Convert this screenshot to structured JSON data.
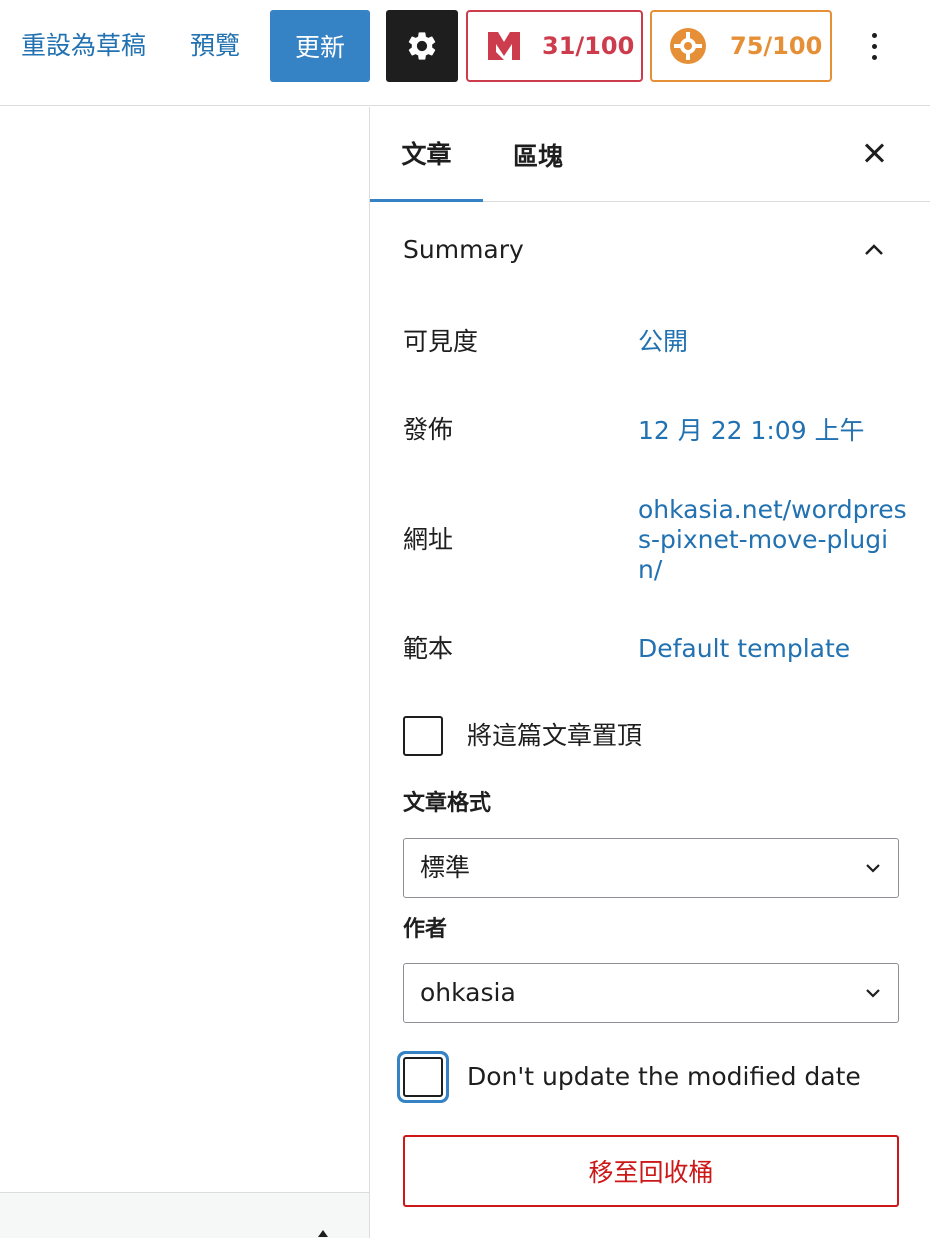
{
  "toolbar": {
    "revert_label": "重設為草稿",
    "preview_label": "預覽",
    "update_label": "更新",
    "settings_icon": "gear-icon",
    "score_red": "31/100",
    "score_orange": "75/100",
    "more_icon": "more-vertical-icon"
  },
  "sidebar": {
    "tabs": [
      {
        "label": "文章"
      },
      {
        "label": "區塊"
      }
    ],
    "summary": {
      "title": "Summary",
      "rows": [
        {
          "label": "可見度",
          "value": "公開"
        },
        {
          "label": "發佈",
          "value": "12 月 22 1:09 上午"
        },
        {
          "label": "網址",
          "value": "ohkasia.net/wordpress-pixnet-move-plugin/"
        },
        {
          "label": "範本",
          "value": "Default template"
        }
      ],
      "sticky_label": "將這篇文章置頂",
      "format": {
        "label": "文章格式",
        "value": "標準"
      },
      "author": {
        "label": "作者",
        "value": "ohkasia"
      },
      "no_modified_label": "Don't update the modified date",
      "trash_label": "移至回收桶"
    }
  },
  "colors": {
    "accent": "#3582c4",
    "link": "#2271b1",
    "danger": "#cc1818",
    "score_red": "#cd3c4c",
    "score_orange": "#e58f36"
  }
}
